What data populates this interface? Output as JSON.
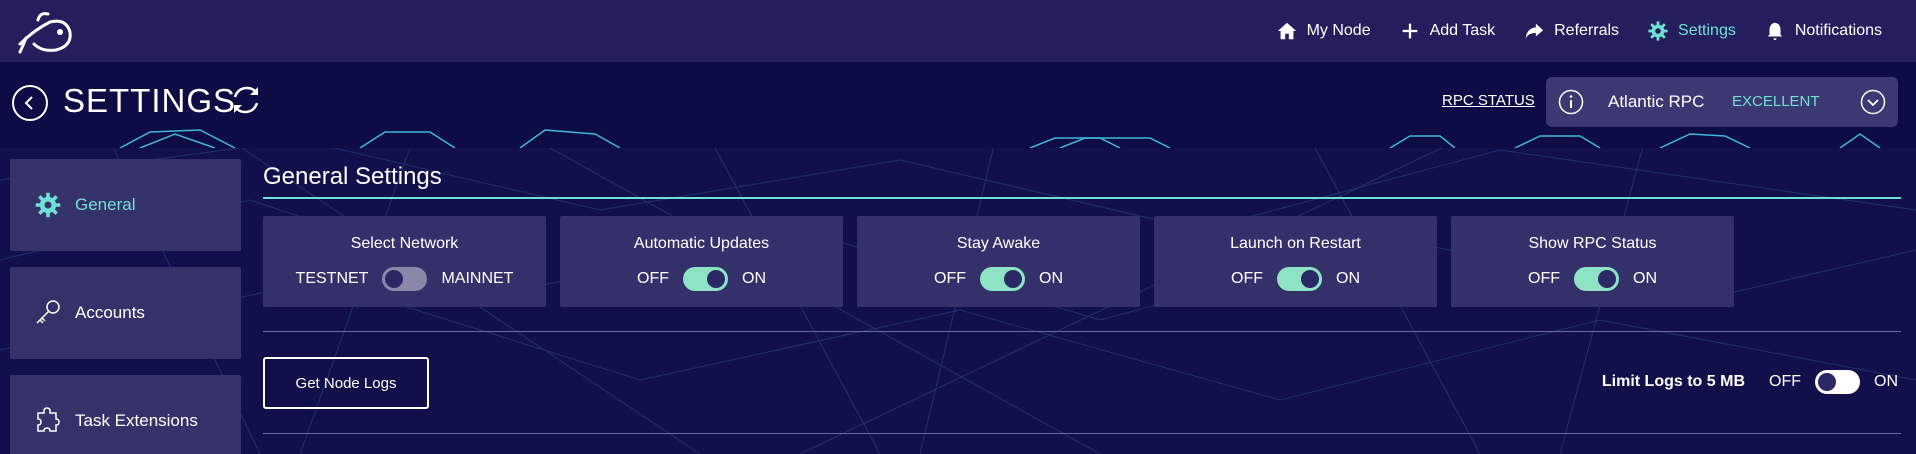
{
  "nav": {
    "items": [
      {
        "label": "My Node",
        "icon": "home-icon"
      },
      {
        "label": "Add Task",
        "icon": "plus-icon"
      },
      {
        "label": "Referrals",
        "icon": "share-arrow-icon"
      },
      {
        "label": "Settings",
        "icon": "gear-icon",
        "active": true
      },
      {
        "label": "Notifications",
        "icon": "bell-icon"
      }
    ]
  },
  "header": {
    "title": "SETTINGS",
    "rpc_status_link": "RPC STATUS",
    "rpc_name": "Atlantic RPC",
    "rpc_quality": "EXCELLENT"
  },
  "sidebar": {
    "items": [
      {
        "label": "General",
        "icon": "gear-icon",
        "active": true
      },
      {
        "label": "Accounts",
        "icon": "key-icon"
      },
      {
        "label": "Task Extensions",
        "icon": "puzzle-icon"
      }
    ]
  },
  "main": {
    "section_title": "General Settings",
    "cards": [
      {
        "title": "Select Network",
        "left_label": "TESTNET",
        "right_label": "MAINNET",
        "on": false
      },
      {
        "title": "Automatic Updates",
        "left_label": "OFF",
        "right_label": "ON",
        "on": true
      },
      {
        "title": "Stay Awake",
        "left_label": "OFF",
        "right_label": "ON",
        "on": true
      },
      {
        "title": "Launch on Restart",
        "left_label": "OFF",
        "right_label": "ON",
        "on": true
      },
      {
        "title": "Show RPC Status",
        "left_label": "OFF",
        "right_label": "ON",
        "on": true
      }
    ],
    "logs_button": "Get Node Logs",
    "limit_logs": {
      "label": "Limit Logs to 5 MB",
      "off_label": "OFF",
      "on_label": "ON",
      "on": false
    }
  },
  "colors": {
    "accent": "#6fe0d6",
    "toggle_on": "#8fe3c5",
    "nav_bg": "#241f5c",
    "page_bg": "#12104a",
    "card_bg": "#34316a"
  }
}
